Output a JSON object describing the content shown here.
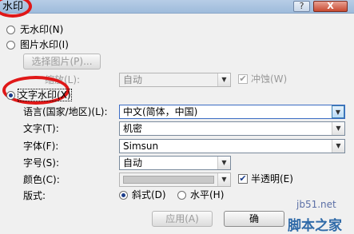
{
  "window": {
    "title": "水印",
    "help_glyph": "?",
    "close_glyph": "X"
  },
  "options": {
    "no_watermark": "无水印(N)",
    "picture_watermark": "图片水印(I)",
    "select_picture": "选择图片(P)...",
    "scale_label": "缩放(L):",
    "scale_value": "自动",
    "washout_label": "冲蚀(W)",
    "text_watermark": "文字水印(X)"
  },
  "fields": {
    "language_label": "语言(国家/地区)(L):",
    "language_value": "中文(简体，中国)",
    "text_label": "文字(T):",
    "text_value": "机密",
    "font_label": "字体(F):",
    "font_value": "Simsun",
    "size_label": "字号(S):",
    "size_value": "自动",
    "color_label": "颜色(C):",
    "semitransparent_label": "半透明(E)",
    "layout_label": "版式:",
    "diagonal_label": "斜式(D)",
    "horizontal_label": "水平(H)"
  },
  "buttons": {
    "apply": "应用(A)",
    "ok": "确"
  },
  "watermark": {
    "site": "jb51.net",
    "brand": "脚本之家"
  }
}
